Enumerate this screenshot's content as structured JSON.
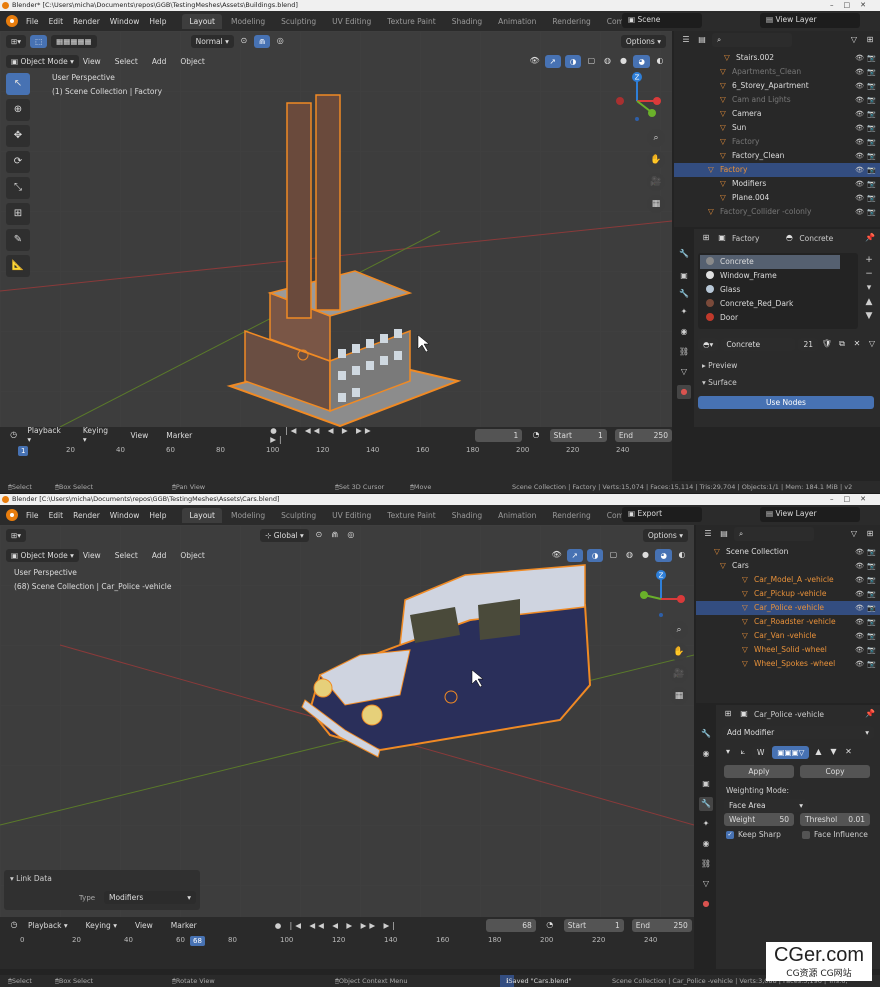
{
  "window1": {
    "title": "Blender* [C:\\Users\\micha\\Documents\\repos\\GGB\\TestingMeshes\\Assets\\Buildings.blend]",
    "menus": [
      "File",
      "Edit",
      "Render",
      "Window",
      "Help"
    ],
    "workspaces": [
      "Layout",
      "Modeling",
      "Sculpting",
      "UV Editing",
      "Texture Paint",
      "Shading",
      "Animation",
      "Rendering",
      "Comp"
    ],
    "active_workspace": "Layout",
    "scene": "Scene",
    "view_layer": "View Layer",
    "header": {
      "mode": "Object Mode",
      "view": "View",
      "select": "Select",
      "add": "Add",
      "object": "Object",
      "orientation": "Normal",
      "options": "Options"
    },
    "overlay": {
      "line1": "User Perspective",
      "line2": "(1) Scene Collection | Factory"
    },
    "outliner": [
      {
        "label": "Stairs.002",
        "style": "normal"
      },
      {
        "label": "Apartments_Clean",
        "style": "gray"
      },
      {
        "label": "6_Storey_Apartment",
        "style": "normal"
      },
      {
        "label": "Cam and Lights",
        "style": "gray"
      },
      {
        "label": "Camera",
        "style": "normal"
      },
      {
        "label": "Sun",
        "style": "normal"
      },
      {
        "label": "Factory",
        "style": "gray"
      },
      {
        "label": "Factory_Clean",
        "style": "normal"
      },
      {
        "label": "Factory",
        "style": "orange-selected"
      },
      {
        "label": "Modifiers",
        "style": "normal"
      },
      {
        "label": "Plane.004",
        "style": "normal"
      },
      {
        "label": "Factory_Collider -colonly",
        "style": "gray"
      }
    ],
    "props": {
      "object": "Factory",
      "material": "Concrete",
      "slots": [
        {
          "name": "Concrete",
          "color": "#8a8a8a"
        },
        {
          "name": "Window_Frame",
          "color": "#e0e0e0"
        },
        {
          "name": "Glass",
          "color": "#b8c8d8"
        },
        {
          "name": "Concrete_Red_Dark",
          "color": "#7a4a3a"
        },
        {
          "name": "Door",
          "color": "#c0392b"
        }
      ],
      "material_field": "Concrete",
      "users": "21",
      "preview": "Preview",
      "surface": "Surface",
      "use_nodes": "Use Nodes"
    },
    "timeline": {
      "playback": "Playback",
      "keying": "Keying",
      "view": "View",
      "marker": "Marker",
      "current_frame": "1",
      "start_label": "Start",
      "start": "1",
      "end_label": "End",
      "end": "250",
      "ticks": [
        "20",
        "40",
        "60",
        "80",
        "100",
        "120",
        "140",
        "160",
        "180",
        "200",
        "220",
        "240"
      ],
      "playhead": "1"
    },
    "status": {
      "select": "Select",
      "box": "Box Select",
      "pan": "Pan View",
      "cursor": "Set 3D Cursor",
      "move": "Move",
      "stats": "Scene Collection | Factory | Verts:15,074 | Faces:15,114 | Tris:29,704 | Objects:1/1 | Mem: 184.1 MiB | v2"
    }
  },
  "window2": {
    "title": "Blender [C:\\Users\\micha\\Documents\\repos\\GGB\\TestingMeshes\\Assets\\Cars.blend]",
    "menus": [
      "File",
      "Edit",
      "Render",
      "Window",
      "Help"
    ],
    "workspaces": [
      "Layout",
      "Modeling",
      "Sculpting",
      "UV Editing",
      "Texture Paint",
      "Shading",
      "Animation",
      "Rendering",
      "Comp"
    ],
    "active_workspace": "Layout",
    "scene": "Export",
    "view_layer": "View Layer",
    "header": {
      "mode": "Object Mode",
      "view": "View",
      "select": "Select",
      "add": "Add",
      "object": "Object",
      "orientation": "Global",
      "options": "Options"
    },
    "overlay": {
      "line1": "User Perspective",
      "line2": "(68) Scene Collection | Car_Police -vehicle"
    },
    "link_data": {
      "title": "Link Data",
      "type_label": "Type",
      "type_value": "Modifiers"
    },
    "outliner": [
      {
        "label": "Scene Collection",
        "style": "normal"
      },
      {
        "label": "Cars",
        "style": "normal"
      },
      {
        "label": "Car_Model_A -vehicle",
        "style": "orange"
      },
      {
        "label": "Car_Pickup -vehicle",
        "style": "orange"
      },
      {
        "label": "Car_Police -vehicle",
        "style": "orange-selected"
      },
      {
        "label": "Car_Roadster -vehicle",
        "style": "orange"
      },
      {
        "label": "Car_Van -vehicle",
        "style": "orange"
      },
      {
        "label": "Wheel_Solid -wheel",
        "style": "orange"
      },
      {
        "label": "Wheel_Spokes -wheel",
        "style": "orange"
      }
    ],
    "props": {
      "object": "Car_Police -vehicle",
      "add_modifier": "Add Modifier",
      "modifier_short": "W",
      "apply": "Apply",
      "copy": "Copy",
      "weighting_mode_label": "Weighting Mode:",
      "weighting_mode": "Face Area",
      "weight_label": "Weight",
      "weight": "50",
      "threshold_label": "Threshol",
      "threshold": "0.01",
      "keep_sharp": "Keep Sharp",
      "face_influence": "Face Influence"
    },
    "timeline": {
      "playback": "Playback",
      "keying": "Keying",
      "view": "View",
      "marker": "Marker",
      "current_frame": "68",
      "start_label": "Start",
      "start": "1",
      "end_label": "End",
      "end": "250",
      "ticks": [
        "0",
        "20",
        "40",
        "60",
        "80",
        "100",
        "120",
        "140",
        "160",
        "180",
        "200",
        "220",
        "240"
      ],
      "playhead": "68"
    },
    "status": {
      "select": "Select",
      "box": "Box Select",
      "rotate": "Rotate View",
      "context": "Object Context Menu",
      "saved": "Saved \"Cars.blend\"",
      "stats": "Scene Collection | Car_Police -vehicle | Verts:3,088 | Faces:3,196 | Tris:6,"
    }
  },
  "watermark": {
    "main": "CGer.com",
    "sub": "CG资源 CG网站"
  }
}
